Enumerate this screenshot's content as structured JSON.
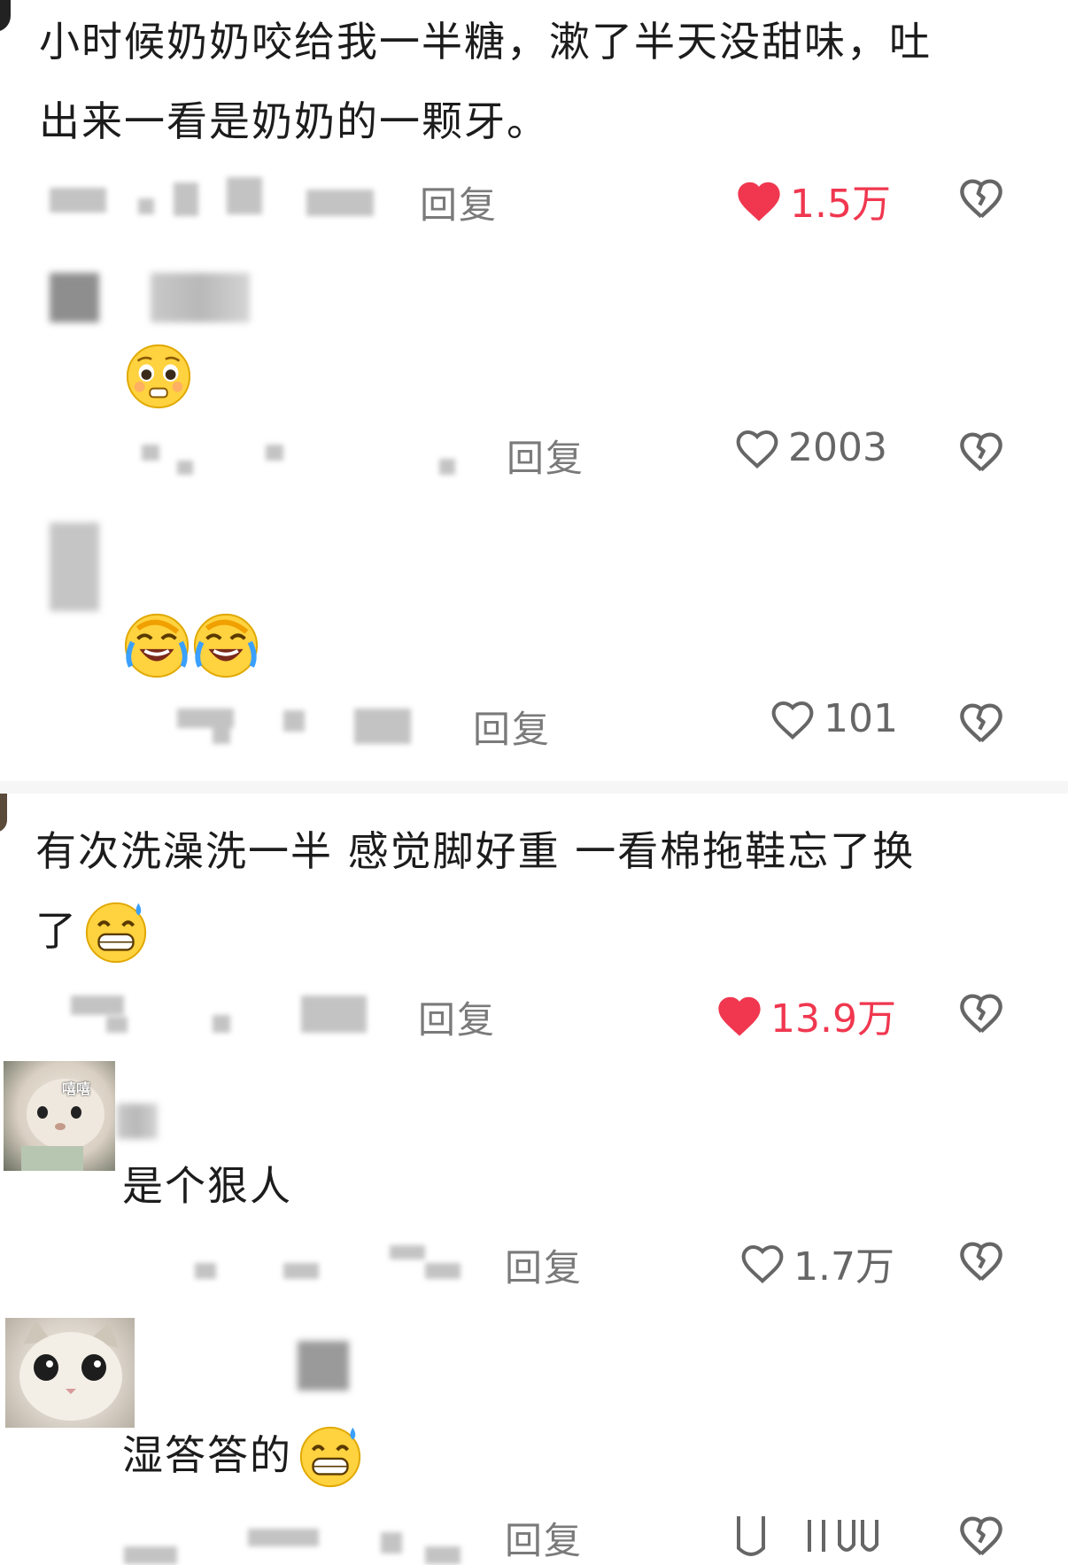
{
  "comments": [
    {
      "text_line1": "小时候奶奶咬给我一半糖，漱了半天没甜味，吐",
      "text_line2": "出来一看是奶奶的一颗牙。",
      "reply_label": "回复",
      "likes": "1.5万",
      "liked": true,
      "replies": [
        {
          "emoji": "pleading-face",
          "reply_label": "回复",
          "likes": "2003",
          "liked": false
        },
        {
          "emoji": "rolling-laughing-face",
          "reply_label": "回复",
          "likes": "101",
          "liked": false
        }
      ]
    },
    {
      "text_line1": "有次洗澡洗一半 感觉脚好重 一看棉拖鞋忘了换",
      "text_line2": "了",
      "reply_label": "回复",
      "likes": "13.9万",
      "liked": true,
      "replies": [
        {
          "text": "是个狠人",
          "avatar_caption": "嘻嘻",
          "reply_label": "回复",
          "likes": "1.7万",
          "liked": false
        },
        {
          "text": "湿答答的",
          "reply_label": "回复",
          "likes": "",
          "liked": false
        }
      ]
    }
  ],
  "colors": {
    "like_active": "#f0374f",
    "like_inactive": "#666666",
    "reply": "#7a7a7a"
  },
  "icons": [
    "heart-filled-icon",
    "heart-outline-icon",
    "broken-heart-icon"
  ]
}
